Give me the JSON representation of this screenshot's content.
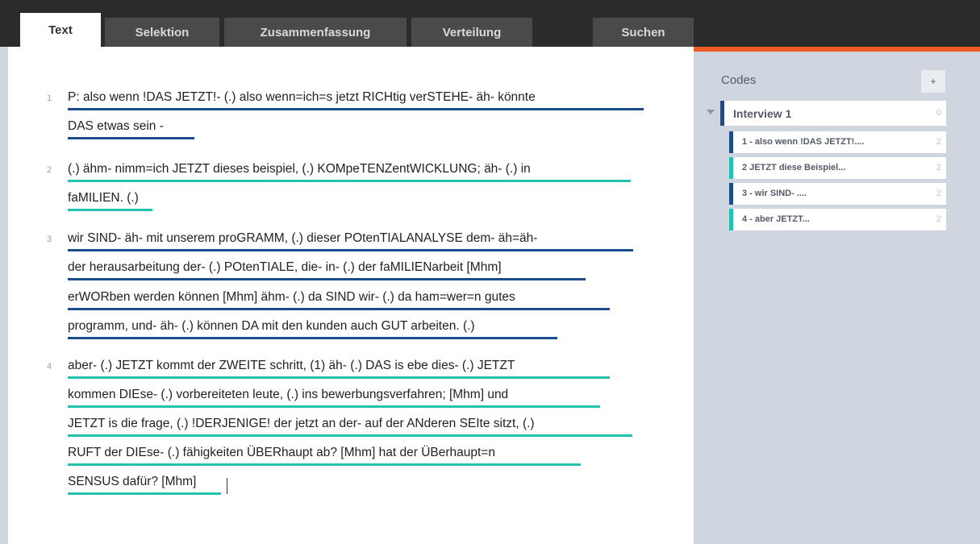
{
  "tabs": [
    {
      "label": "Text",
      "active": true
    },
    {
      "label": "Selektion",
      "active": false
    },
    {
      "label": "Zusammenfassung",
      "active": false
    },
    {
      "label": "Verteilung",
      "active": false
    },
    {
      "label": "Suchen",
      "active": false
    }
  ],
  "colors": {
    "accent": "#ee5c24",
    "code_blue": "#1b4d8c",
    "code_teal": "#22c2ae",
    "topbar": "#2b2b2b"
  },
  "transcript": {
    "paragraphs": [
      {
        "number": "1",
        "lines": [
          "P:   also wenn !DAS JETZT!- (.) also wenn=ich=s jetzt RICHtig verSTEHE- äh- könnte",
          "DAS etwas sein -"
        ]
      },
      {
        "number": "2",
        "lines": [
          "(.) ähm- nimm=ich JETZT dieses beispiel, (.) KOMpeTENZentWICKLUNG; äh- (.) in",
          "faMILIEN. (.)"
        ]
      },
      {
        "number": "3",
        "lines": [
          "wir SIND- äh- mit unserem proGRAMM, (.) dieser POtenTIALANALYSE dem- äh=äh-",
          "der herausarbeitung der- (.) POtenTIALE, die- in- (.) der faMILIENarbeit [Mhm]",
          "erWORben werden können [Mhm] ähm- (.) da SIND wir- (.) da ham=wer=n gutes",
          "programm, und- äh- (.) können DA mit den kunden auch GUT arbeiten. (.)"
        ]
      },
      {
        "number": "4",
        "lines": [
          "aber- (.) JETZT kommt der ZWEITE schritt, (1) äh- (.) DAS is ebe dies- (.) JETZT",
          "kommen DIEse- (.) vorbereiteten leute, (.) ins bewerbungsverfahren; [Mhm] und",
          "JETZT is die frage, (.) !DERJENIGE! der jetzt an der- auf der ANderen SEIte sitzt, (.)",
          "RUFT der DIEse- (.) fähigkeiten ÜBERhaupt ab? [Mhm] hat der ÜBerhaupt=n",
          "SENSUS dafür? [Mhm]"
        ]
      }
    ]
  },
  "codes_panel": {
    "title": "Codes",
    "add_label": "+",
    "interview": {
      "label": "Interview 1",
      "count": "0"
    },
    "items": [
      {
        "label": "1 - also wenn !DAS JETZT!....",
        "count": "2",
        "color": "#1b4d8c"
      },
      {
        "label": "2 JETZT diese Beispiel...",
        "count": "2",
        "color": "#22c2ae"
      },
      {
        "label": "3 - wir SIND- ....",
        "count": "2",
        "color": "#1b4d8c"
      },
      {
        "label": "4 - aber JETZT...",
        "count": "2",
        "color": "#22c2ae"
      }
    ]
  }
}
